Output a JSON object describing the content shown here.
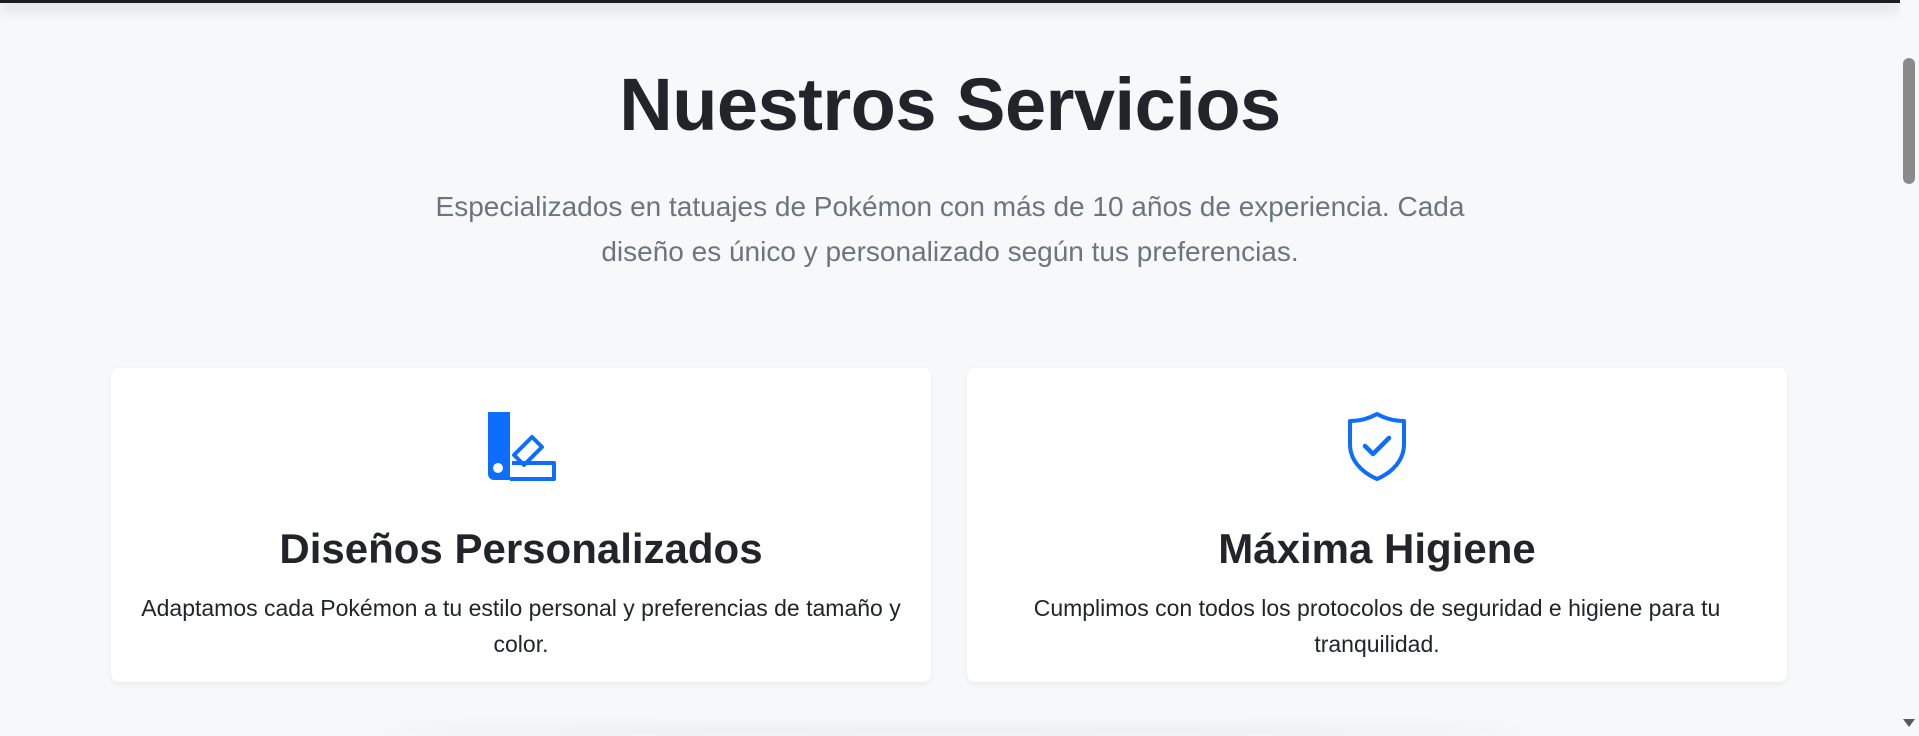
{
  "services": {
    "title": "Nuestros Servicios",
    "subtitle": "Especializados en tatuajes de Pokémon con más de 10 años de experiencia. Cada diseño es único y personalizado según tus preferencias.",
    "cards": [
      {
        "icon": "palette-swatch-icon",
        "title": "Diseños Personalizados",
        "text": "Adaptamos cada Pokémon a tu estilo personal y preferencias de tamaño y color."
      },
      {
        "icon": "shield-check-icon",
        "title": "Máxima Higiene",
        "text": "Cumplimos con todos los protocolos de seguridad e higiene para tu tranquilidad."
      }
    ]
  },
  "colors": {
    "accent": "#0d6efd",
    "background": "#f7f8fa",
    "card": "#ffffff",
    "heading": "#212529",
    "muted": "#6c757d"
  }
}
